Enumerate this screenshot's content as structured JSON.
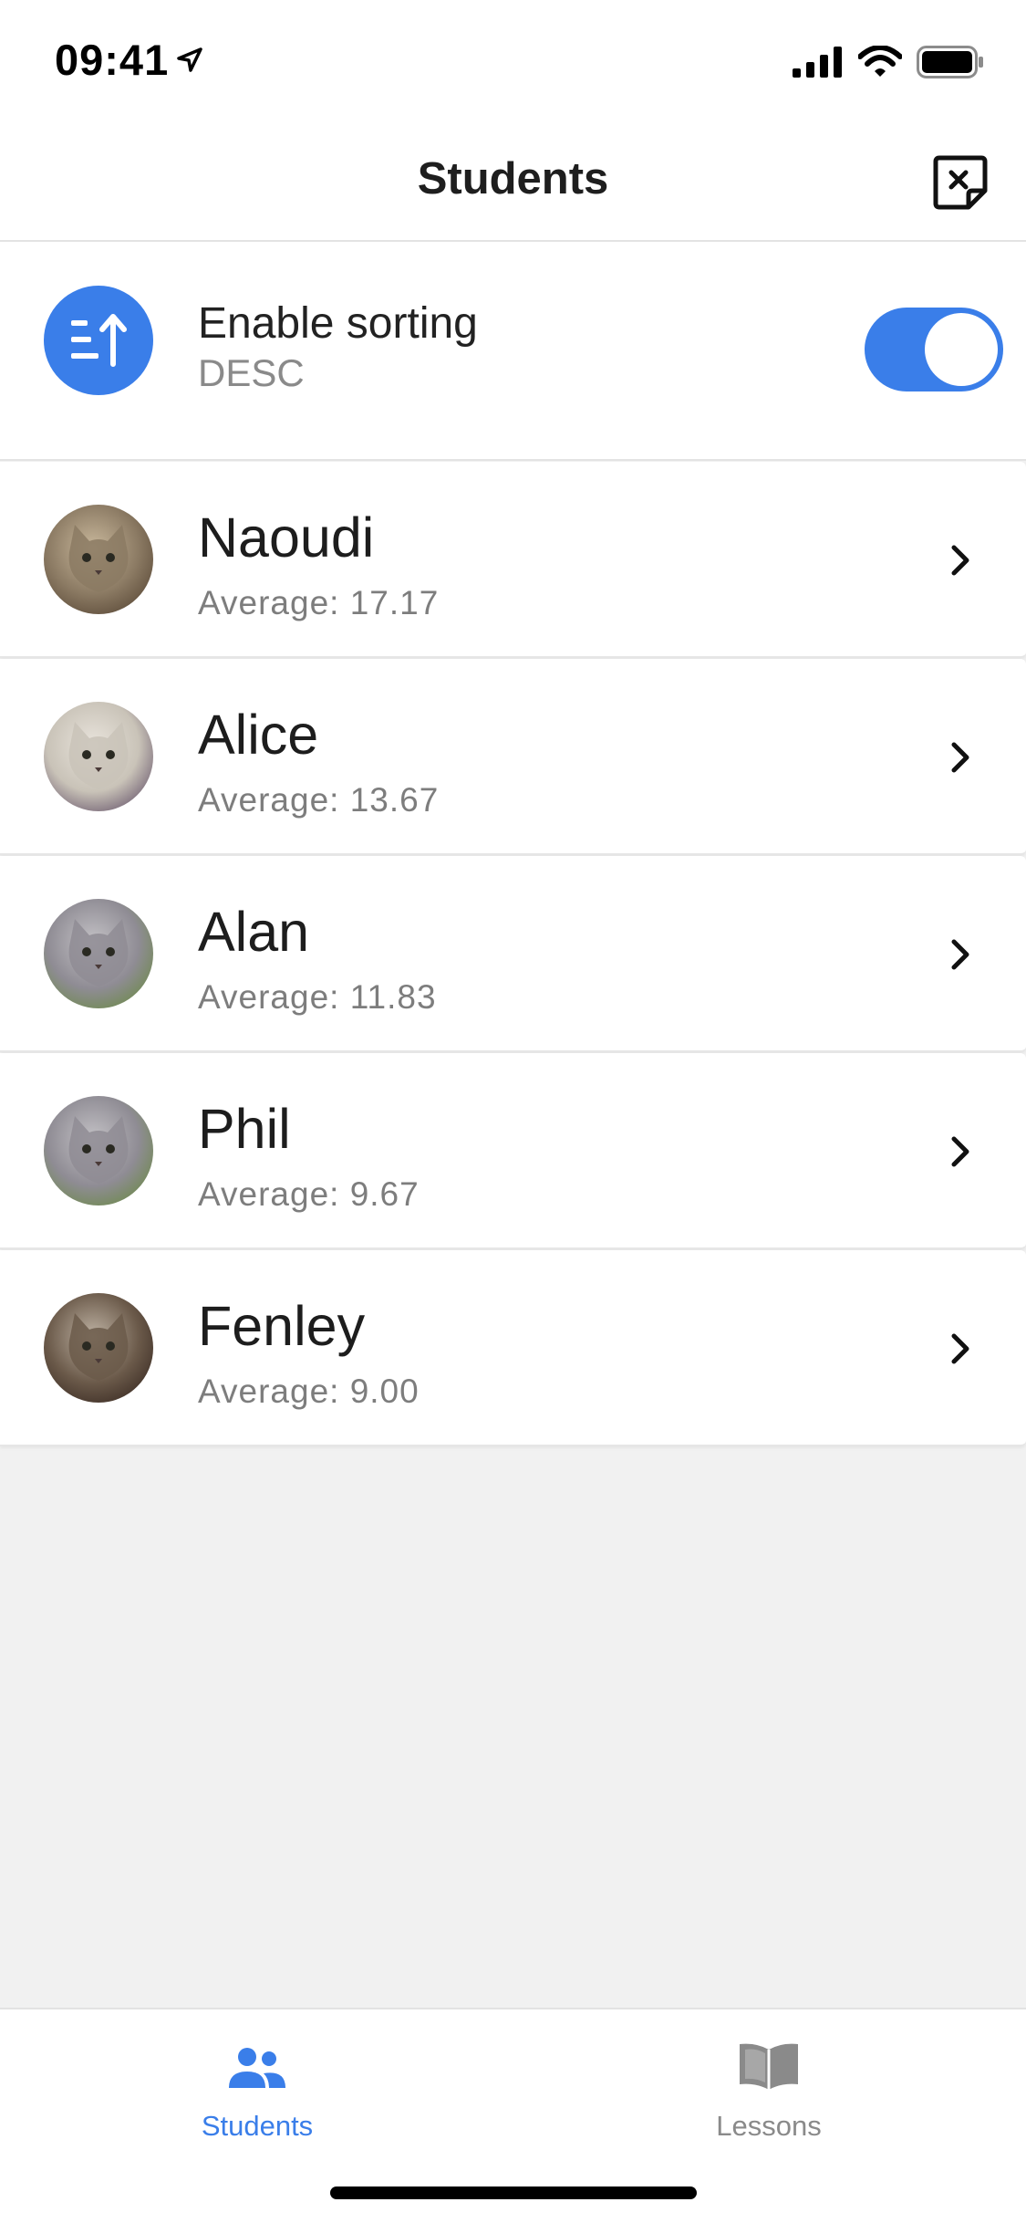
{
  "status_bar": {
    "time": "09:41"
  },
  "header": {
    "title": "Students",
    "close_icon": "close-square-icon"
  },
  "sorting": {
    "label": "Enable sorting",
    "order": "DESC",
    "enabled": true,
    "icon": "sort-icon",
    "accent": "#3a7ee9"
  },
  "students": [
    {
      "name": "Naoudi",
      "average": "Average: 17.17",
      "avatar_colors": [
        "#8b7a63",
        "#c9b89c",
        "#5b4a38"
      ]
    },
    {
      "name": "Alice",
      "average": "Average: 13.67",
      "avatar_colors": [
        "#c9c3b8",
        "#e9e4dc",
        "#6b5a6e"
      ]
    },
    {
      "name": "Alan",
      "average": "Average: 11.83",
      "avatar_colors": [
        "#8f8c94",
        "#c4c2c6",
        "#6d8a4a"
      ]
    },
    {
      "name": "Phil",
      "average": "Average: 9.67",
      "avatar_colors": [
        "#8f8c94",
        "#c4c2c6",
        "#6d8a4a"
      ]
    },
    {
      "name": "Fenley",
      "average": "Average: 9.00",
      "avatar_colors": [
        "#6b5a4a",
        "#bfb3a4",
        "#3b2c24"
      ]
    }
  ],
  "tabs": [
    {
      "label": "Students",
      "active": true,
      "icon": "people-icon",
      "color": "#3a7ee9"
    },
    {
      "label": "Lessons",
      "active": false,
      "icon": "book-icon",
      "color": "#8a8a8a"
    }
  ]
}
